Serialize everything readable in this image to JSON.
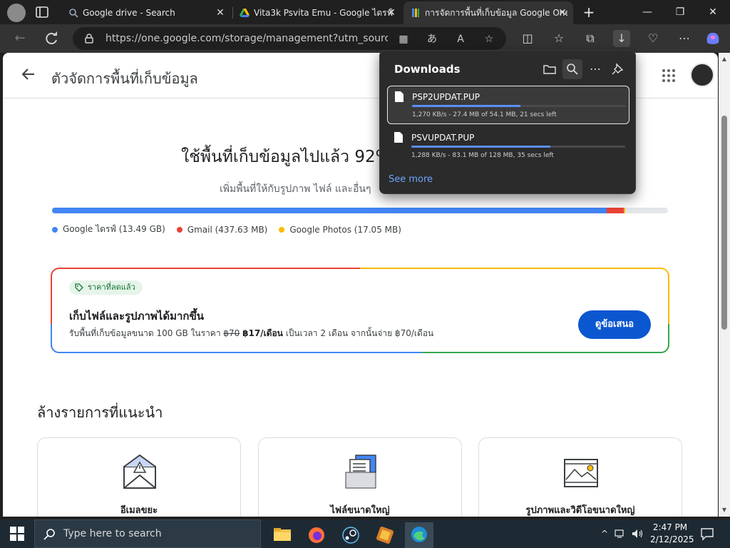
{
  "browser": {
    "tabs": [
      {
        "title": "Google drive - Search",
        "close": "✕"
      },
      {
        "title": "Vita3k Psvita Emu - Google ไดรฟ์",
        "close": "✕"
      },
      {
        "title": "การจัดการพื้นที่เก็บข้อมูล Google One",
        "close": "✕",
        "active": true
      }
    ],
    "new_tab": "+",
    "window_controls": {
      "minimize": "—",
      "maximize": "❐",
      "close": "✕"
    },
    "url": "https://one.google.com/storage/management?utm_source=d...",
    "omni_icons": [
      "▦",
      "あ",
      "A",
      "☆"
    ],
    "toolbar_icons": [
      "◫",
      "☆",
      "⧉",
      "↓",
      "♡",
      "⋯"
    ]
  },
  "page": {
    "title": "ตัวจัดการพื้นที่เก็บข้อมูล",
    "usage_title": "ใช้พื้นที่เก็บข้อมูลไปแล้ว 92%",
    "usage_sub": "เพิ่มพื้นที่ให้กับรูปภาพ ไฟล์ และอื่นๆ",
    "storage_fraction": {
      "drive": 0.9,
      "gmail": 0.028,
      "photos": 0.002
    },
    "legend": [
      {
        "label": "Google ไดรฟ์ (13.49 GB)",
        "color": "#4285f4"
      },
      {
        "label": "Gmail (437.63 MB)",
        "color": "#ea4335"
      },
      {
        "label": "Google Photos (17.05 MB)",
        "color": "#fbbc04"
      }
    ],
    "offer": {
      "badge": "ราคาที่ลดแล้ว",
      "title": "เก็บไฟล์และรูปภาพได้มากขึ้น",
      "desc_prefix": "รับพื้นที่เก็บข้อมูลขนาด 100 GB ในราคา ",
      "old_price": "฿70",
      "new_price": "฿17/เดือน",
      "desc_suffix": " เป็นเวลา 2 เดือน จากนั้นจ่าย ฿70/เดือน",
      "button": "ดูข้อเสนอ"
    },
    "section_title": "ล้างรายการที่แนะนำ",
    "cards": [
      {
        "label": "อีเมลขยะ"
      },
      {
        "label": "ไฟล์ขนาดใหญ่"
      },
      {
        "label": "รูปภาพและวิดีโอขนาดใหญ่"
      }
    ]
  },
  "downloads": {
    "title": "Downloads",
    "items": [
      {
        "name": "PSP2UPDAT.PUP",
        "meta": "1,270 KB/s - 27.4 MB of 54.1 MB, 21 secs left",
        "progress": 0.506
      },
      {
        "name": "PSVUPDAT.PUP",
        "meta": "1,288 KB/s - 83.1 MB of 128 MB, 35 secs left",
        "progress": 0.649
      }
    ],
    "see_more": "See more"
  },
  "taskbar": {
    "search_placeholder": "Type here to search",
    "time": "2:47 PM",
    "date": "2/12/2025"
  }
}
